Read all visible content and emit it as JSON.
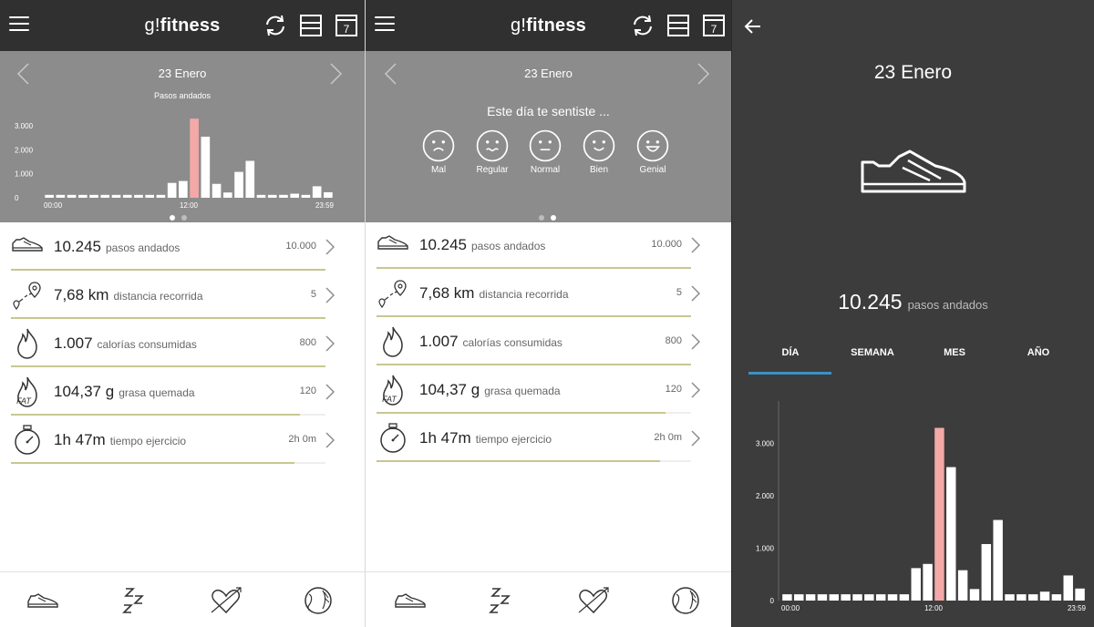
{
  "app": {
    "logo_prefix": "g!",
    "logo_main": "fitness"
  },
  "day": {
    "date": "23 Enero",
    "chart_subtitle": "Pasos andados"
  },
  "feel": {
    "title": "Este día te sentiste ...",
    "moods": [
      {
        "label": "Mal",
        "icon": "sad-face-icon"
      },
      {
        "label": "Regular",
        "icon": "wavy-face-icon"
      },
      {
        "label": "Normal",
        "icon": "neutral-face-icon"
      },
      {
        "label": "Bien",
        "icon": "smile-face-icon"
      },
      {
        "label": "Genial",
        "icon": "big-smile-face-icon"
      }
    ]
  },
  "stats": [
    {
      "value": "10.245",
      "label": "pasos andados",
      "goal": "10.000",
      "progress": 1.0,
      "icon": "shoe-icon"
    },
    {
      "value": "7,68 km",
      "label": "distancia recorrida",
      "goal": "5",
      "progress": 1.0,
      "icon": "route-pin-icon"
    },
    {
      "value": "1.007",
      "label": "calorías consumidas",
      "goal": "800",
      "progress": 1.0,
      "icon": "flame-icon"
    },
    {
      "value": "104,37 g",
      "label": "grasa quemada",
      "goal": "120",
      "progress": 0.92,
      "icon": "fat-flame-icon"
    },
    {
      "value": "1h 47m",
      "label": "tiempo ejercicio",
      "goal": "2h 0m",
      "progress": 0.9,
      "icon": "stopwatch-icon"
    }
  ],
  "detail": {
    "date": "23 Enero",
    "steps_value": "10.245",
    "steps_label": "pasos andados",
    "tabs": [
      "DÍA",
      "SEMANA",
      "MES",
      "AÑO"
    ],
    "active_tab": "DÍA"
  },
  "colors": {
    "topbar": "#303030",
    "graybox": "#8c8c8c",
    "highlight_bar": "#f4a8a8",
    "bar": "#ffffff",
    "progress": "#c8c690",
    "tab_underline": "#3b90c4",
    "detail_bg": "#3c3c3c"
  },
  "chart_data": {
    "type": "bar",
    "title": "Pasos andados",
    "y_ticks": [
      "0",
      "1.000",
      "2.000",
      "3.000"
    ],
    "x_ticks": [
      "00:00",
      "12:00",
      "23:59"
    ],
    "ylim": [
      0,
      3500
    ],
    "values": [
      120,
      120,
      120,
      120,
      120,
      120,
      120,
      120,
      120,
      120,
      120,
      620,
      700,
      3300,
      2550,
      580,
      220,
      1080,
      1540,
      120,
      120,
      120,
      170,
      120,
      480,
      230
    ],
    "highlight_index": 13
  }
}
